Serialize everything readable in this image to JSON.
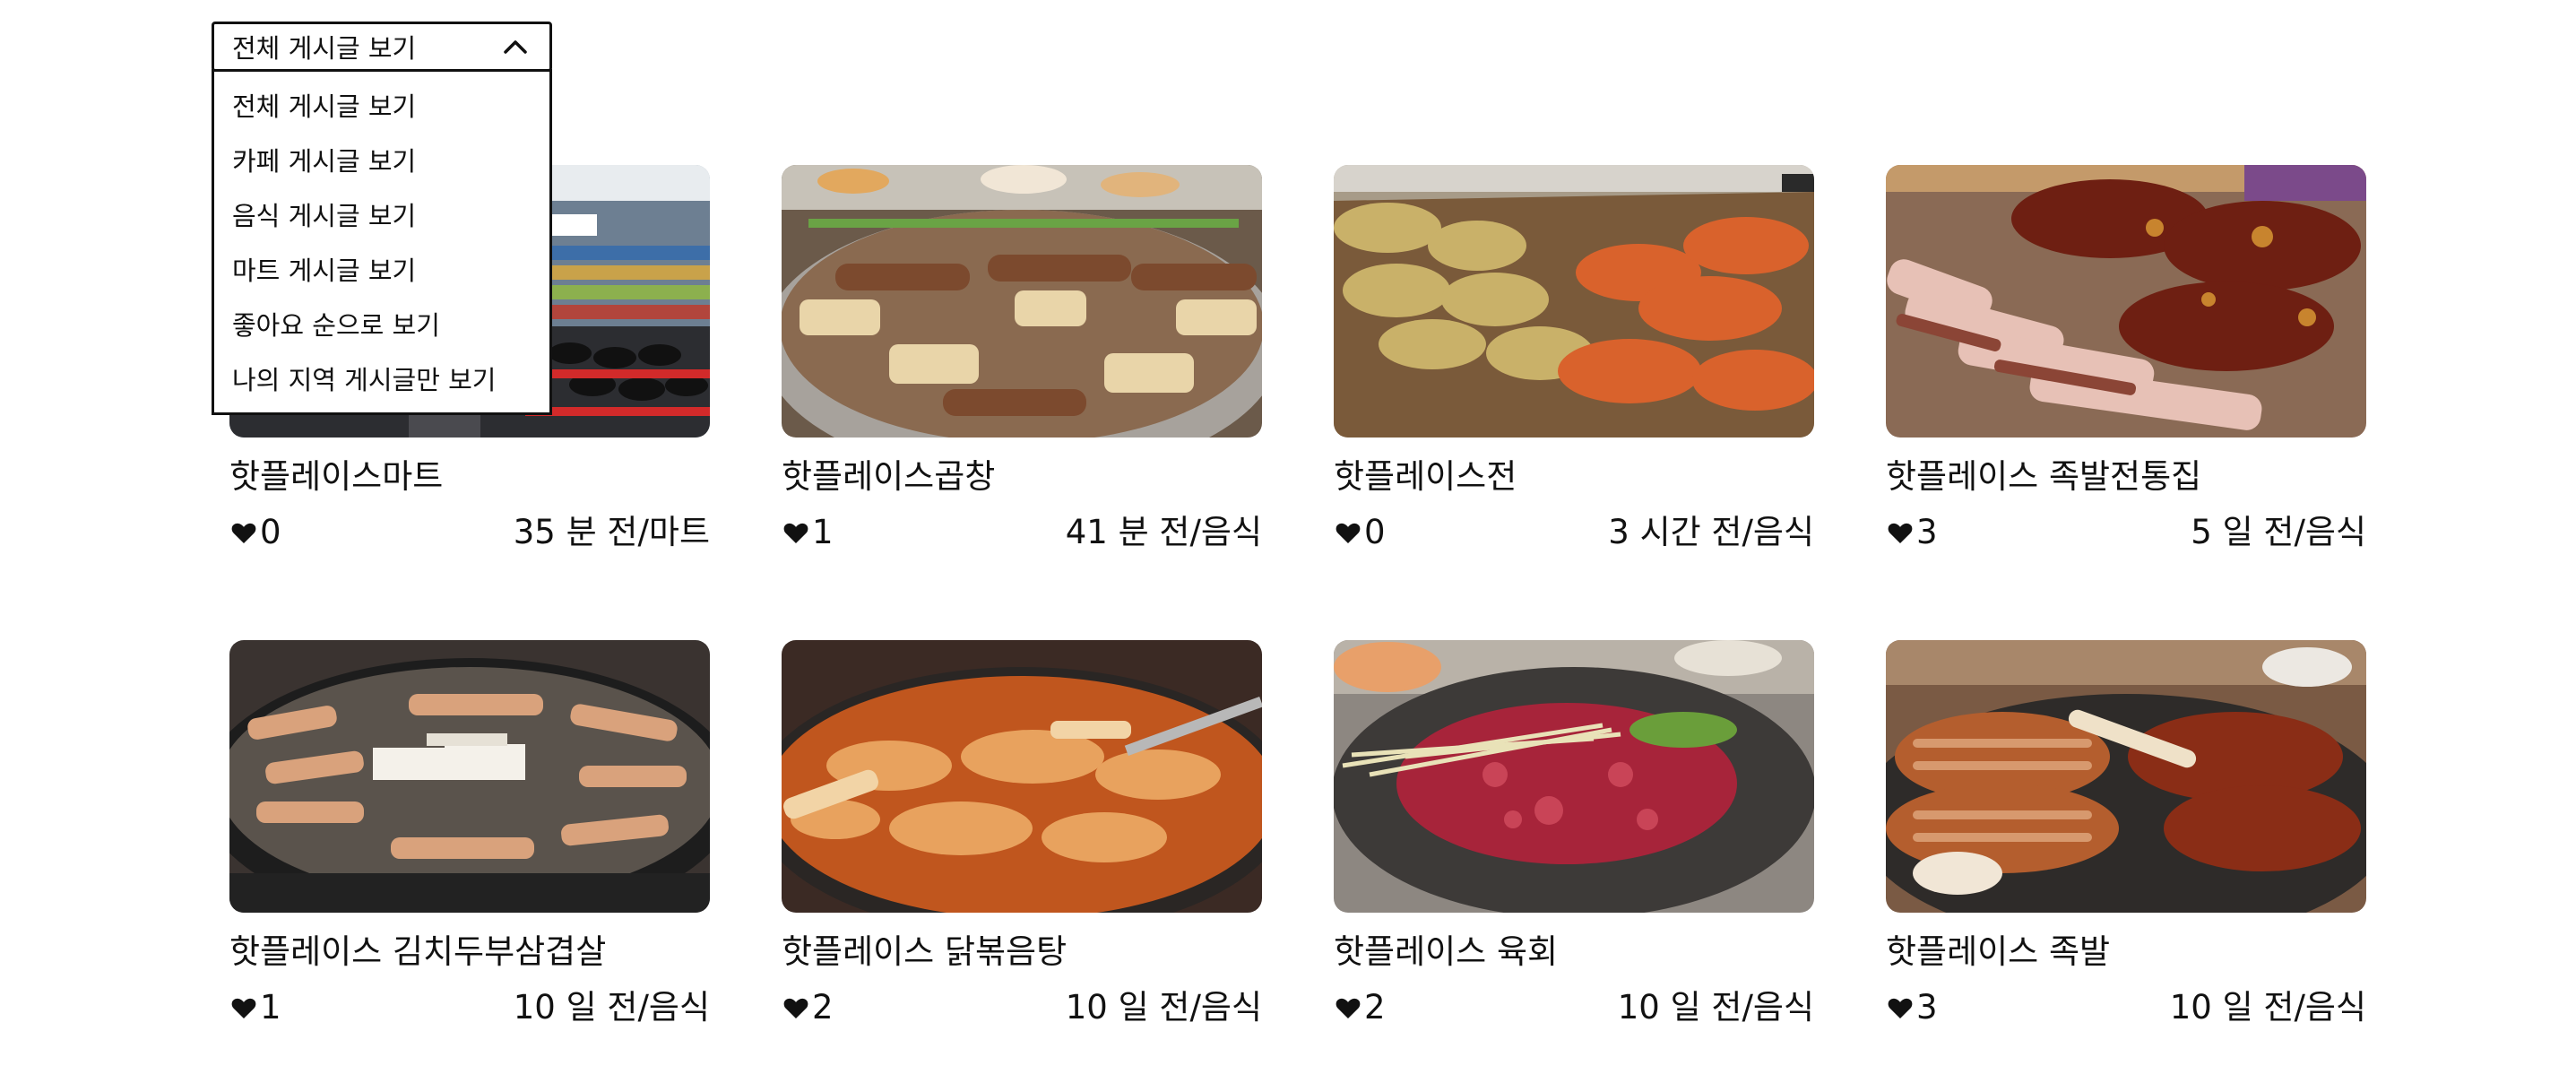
{
  "filter": {
    "selected": "전체 게시글 보기",
    "options": [
      "전체 게시글 보기",
      "카페 게시글 보기",
      "음식 게시글 보기",
      "마트 게시글 보기",
      "좋아요 순으로 보기",
      "나의 지역 게시글만 보기"
    ]
  },
  "posts": [
    {
      "title": "핫플레이스마트",
      "likes": "0",
      "meta": "35 분 전/마트",
      "image": "mart-photo"
    },
    {
      "title": "핫플레이스곱창",
      "likes": "1",
      "meta": "41 분 전/음식",
      "image": "gopchang-photo"
    },
    {
      "title": "핫플레이스전",
      "likes": "0",
      "meta": "3 시간 전/음식",
      "image": "jeon-photo"
    },
    {
      "title": "핫플레이스 족발전통집",
      "likes": "3",
      "meta": "5 일 전/음식",
      "image": "jokbal-platter-photo"
    },
    {
      "title": "핫플레이스 김치두부삼겹살",
      "likes": "1",
      "meta": "10 일 전/음식",
      "image": "samgyeopsal-photo"
    },
    {
      "title": "핫플레이스 닭볶음탕",
      "likes": "2",
      "meta": "10 일 전/음식",
      "image": "dakbokkeumtang-photo"
    },
    {
      "title": "핫플레이스 육회",
      "likes": "2",
      "meta": "10 일 전/음식",
      "image": "yukhoe-photo"
    },
    {
      "title": "핫플레이스 족발",
      "likes": "3",
      "meta": "10 일 전/음식",
      "image": "jokbal-photo"
    }
  ],
  "colors": {
    "border": "#111111",
    "text": "#111111"
  }
}
